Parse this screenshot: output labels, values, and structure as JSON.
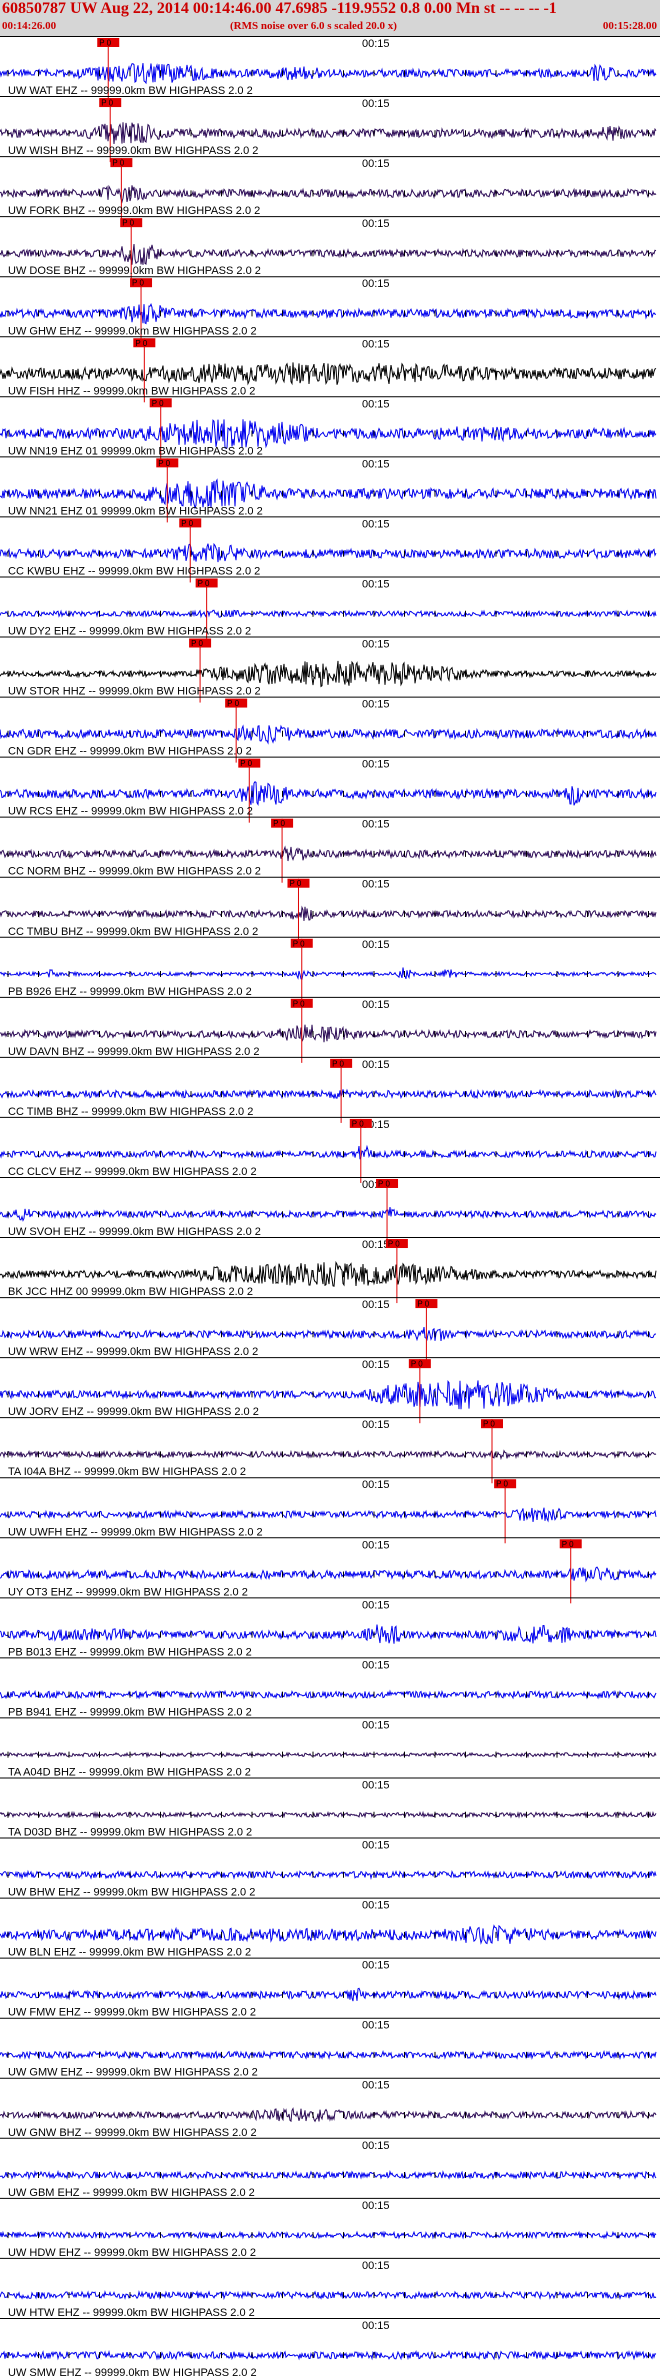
{
  "header": {
    "title": "60850787 UW Aug 22, 2014 00:14:46.00   47.6985 -119.9552  0.8 0.00 Mn st -- -- --  -1",
    "start_time": "00:14:26.00",
    "note": "(RMS noise over 6.0 s scaled 20.0 x)",
    "end_time": "00:15:28.00"
  },
  "time_marker": "00:15",
  "pick_label": "P 0",
  "colors": {
    "blue": "#0000ee",
    "black": "#000000",
    "purple": "#2b0a55",
    "pick": "#e00000"
  },
  "traces": [
    {
      "label": "UW WAT EHZ -- 99999.0km BW  HIGHPASS  2.0  2",
      "color": "blue",
      "amp": 0.55,
      "pick": 0.165,
      "burst": [
        0.12,
        0.42,
        2.6
      ],
      "extra": [
        [
          0.4,
          0.5,
          1.8
        ],
        [
          0.88,
          0.94,
          2.2
        ]
      ]
    },
    {
      "label": "UW WISH BHZ -- 99999.0km BW  HIGHPASS  2.0  2",
      "color": "purple",
      "amp": 0.6,
      "pick": 0.168,
      "burst": [
        0.13,
        0.3,
        2.6
      ],
      "extra": [
        [
          0.9,
          0.96,
          1.8
        ]
      ]
    },
    {
      "label": "UW FORK BHZ -- 99999.0km BW  HIGHPASS  2.0  2",
      "color": "purple",
      "amp": 0.55,
      "pick": 0.185,
      "burst": [
        0.15,
        0.26,
        2.2
      ],
      "extra": []
    },
    {
      "label": "UW DOSE BHZ -- 99999.0km BW  HIGHPASS  2.0  2",
      "color": "purple",
      "amp": 0.5,
      "pick": 0.2,
      "burst": [
        0.18,
        0.27,
        3.4
      ],
      "extra": []
    },
    {
      "label": "UW GHW EHZ -- 99999.0km BW  HIGHPASS  2.0  2",
      "color": "blue",
      "amp": 0.6,
      "pick": 0.215,
      "burst": [
        0.18,
        0.3,
        2.4
      ],
      "extra": []
    },
    {
      "label": "UW FISH HHZ -- 99999.0km BW  HIGHPASS  2.0  2",
      "color": "black",
      "amp": 0.8,
      "pick": 0.22,
      "burst": [
        0.2,
        1.0,
        2.0
      ],
      "extra": []
    },
    {
      "label": "UW NN19 EHZ 01 99999.0km BW  HIGHPASS  2.0  2",
      "color": "blue",
      "amp": 0.7,
      "pick": 0.245,
      "burst": [
        0.22,
        0.6,
        3.0
      ],
      "extra": [
        [
          0.65,
          0.8,
          1.6
        ]
      ]
    },
    {
      "label": "UW NN21 EHZ 01 99999.0km BW  HIGHPASS  2.0  2",
      "color": "blue",
      "amp": 0.7,
      "pick": 0.255,
      "burst": [
        0.22,
        0.5,
        3.0
      ],
      "extra": []
    },
    {
      "label": "CC KWBU EHZ -- 99999.0km BW  HIGHPASS  2.0  2",
      "color": "blue",
      "amp": 0.6,
      "pick": 0.29,
      "burst": [
        0.26,
        0.42,
        2.6
      ],
      "extra": []
    },
    {
      "label": "UW DY2 EHZ -- 99999.0km BW  HIGHPASS  2.0  2",
      "color": "blue",
      "amp": 0.35,
      "pick": 0.315,
      "burst": [
        0.3,
        0.4,
        1.6
      ],
      "extra": []
    },
    {
      "label": "UW STOR HHZ -- 99999.0km BW  HIGHPASS  2.0  2",
      "color": "black",
      "amp": 0.4,
      "pick": 0.305,
      "burst": [
        0.3,
        0.92,
        4.5
      ],
      "extra": []
    },
    {
      "label": "CN GDR EHZ -- 99999.0km BW  HIGHPASS  2.0  2",
      "color": "blue",
      "amp": 0.6,
      "pick": 0.36,
      "burst": [
        0.35,
        0.5,
        2.2
      ],
      "extra": []
    },
    {
      "label": "UW RCS EHZ -- 99999.0km BW  HIGHPASS  2.0  2",
      "color": "blue",
      "amp": 0.6,
      "pick": 0.38,
      "burst": [
        0.36,
        0.48,
        3.0
      ],
      "extra": [
        [
          0.86,
          0.89,
          3.2
        ]
      ]
    },
    {
      "label": "CC NORM BHZ -- 99999.0km BW  HIGHPASS  2.0  2",
      "color": "purple",
      "amp": 0.5,
      "pick": 0.43,
      "burst": [
        0.42,
        0.5,
        2.2
      ],
      "extra": []
    },
    {
      "label": "CC TMBU BHZ -- 99999.0km BW  HIGHPASS  2.0  2",
      "color": "purple",
      "amp": 0.45,
      "pick": 0.455,
      "burst": [
        0.44,
        0.5,
        2.4
      ],
      "extra": []
    },
    {
      "label": "PB B926 EHZ -- 99999.0km BW  HIGHPASS  2.0  2",
      "color": "blue",
      "amp": 0.25,
      "pick": 0.46,
      "burst": [
        0.45,
        0.48,
        3.0
      ],
      "extra": [
        [
          0.07,
          0.09,
          4.0
        ],
        [
          0.6,
          0.63,
          4.0
        ],
        [
          0.67,
          0.7,
          3.0
        ]
      ]
    },
    {
      "label": "UW DAVN BHZ -- 99999.0km BW  HIGHPASS  2.0  2",
      "color": "purple",
      "amp": 0.5,
      "pick": 0.46,
      "burst": [
        0.42,
        0.6,
        3.0
      ],
      "extra": []
    },
    {
      "label": "CC TIMB BHZ -- 99999.0km BW  HIGHPASS  2.0  2",
      "color": "blue",
      "amp": 0.5,
      "pick": 0.52,
      "burst": [
        0.5,
        0.55,
        1.5
      ],
      "extra": []
    },
    {
      "label": "CC CLCV EHZ -- 99999.0km BW  HIGHPASS  2.0  2",
      "color": "blue",
      "amp": 0.45,
      "pick": 0.55,
      "burst": [
        0.54,
        0.58,
        3.2
      ],
      "extra": []
    },
    {
      "label": "UW SVOH EHZ -- 99999.0km BW  HIGHPASS  2.0  2",
      "color": "blue",
      "amp": 0.45,
      "pick": 0.59,
      "burst": [
        0.58,
        0.62,
        2.2
      ],
      "extra": [
        [
          0.02,
          0.05,
          2.2
        ]
      ]
    },
    {
      "label": "BK JCC HHZ 00 99999.0km BW  HIGHPASS  2.0  2",
      "color": "black",
      "amp": 0.5,
      "pick": 0.605,
      "burst": [
        0.28,
        0.95,
        3.4
      ],
      "extra": []
    },
    {
      "label": "UW WRW EHZ -- 99999.0km BW  HIGHPASS  2.0  2",
      "color": "blue",
      "amp": 0.5,
      "pick": 0.65,
      "burst": [
        0.62,
        0.72,
        2.2
      ],
      "extra": []
    },
    {
      "label": "UW JORV EHZ -- 99999.0km BW  HIGHPASS  2.0  2",
      "color": "blue",
      "amp": 0.5,
      "pick": 0.64,
      "burst": [
        0.55,
        0.98,
        4.2
      ],
      "extra": []
    },
    {
      "label": "TA I04A BHZ -- 99999.0km BW  HIGHPASS  2.0  2",
      "color": "purple",
      "amp": 0.4,
      "pick": 0.75,
      "burst": [
        0.74,
        0.8,
        1.6
      ],
      "extra": []
    },
    {
      "label": "UW UWFH EHZ -- 99999.0km BW  HIGHPASS  2.0  2",
      "color": "blue",
      "amp": 0.45,
      "pick": 0.77,
      "burst": [
        0.78,
        0.9,
        2.6
      ],
      "extra": []
    },
    {
      "label": "UY OT3 EHZ -- 99999.0km BW  HIGHPASS  2.0  2",
      "color": "blue",
      "amp": 0.55,
      "pick": 0.87,
      "burst": [
        0.86,
        0.98,
        2.0
      ],
      "extra": []
    },
    {
      "label": "PB B013 EHZ -- 99999.0km BW  HIGHPASS  2.0  2",
      "color": "blue",
      "amp": 0.55,
      "pick": null,
      "burst": [
        0.05,
        0.3,
        1.6
      ],
      "extra": [
        [
          0.55,
          0.62,
          2.8
        ],
        [
          0.75,
          0.9,
          2.4
        ]
      ]
    },
    {
      "label": "PB B941 EHZ -- 99999.0km BW  HIGHPASS  2.0  2",
      "color": "blue",
      "amp": 0.45,
      "pick": null,
      "burst": null,
      "extra": []
    },
    {
      "label": "TA A04D BHZ -- 99999.0km BW  HIGHPASS  2.0  2",
      "color": "purple",
      "amp": 0.25,
      "pick": null,
      "burst": null,
      "extra": []
    },
    {
      "label": "TA D03D BHZ -- 99999.0km BW  HIGHPASS  2.0  2",
      "color": "purple",
      "amp": 0.3,
      "pick": null,
      "burst": null,
      "extra": []
    },
    {
      "label": "UW BHW EHZ -- 99999.0km BW  HIGHPASS  2.0  2",
      "color": "blue",
      "amp": 0.45,
      "pick": null,
      "burst": null,
      "extra": []
    },
    {
      "label": "UW BLN EHZ -- 99999.0km BW  HIGHPASS  2.0  2",
      "color": "blue",
      "amp": 0.6,
      "pick": null,
      "burst": [
        0.05,
        0.95,
        1.5
      ],
      "extra": [
        [
          0.65,
          0.85,
          2.2
        ]
      ]
    },
    {
      "label": "UW FMW EHZ -- 99999.0km BW  HIGHPASS  2.0  2",
      "color": "blue",
      "amp": 0.5,
      "pick": null,
      "burst": [
        0.53,
        0.57,
        2.2
      ],
      "extra": []
    },
    {
      "label": "UW GMW EHZ -- 99999.0km BW  HIGHPASS  2.0  2",
      "color": "blue",
      "amp": 0.45,
      "pick": null,
      "burst": null,
      "extra": []
    },
    {
      "label": "UW GNW BHZ -- 99999.0km BW  HIGHPASS  2.0  2",
      "color": "purple",
      "amp": 0.45,
      "pick": null,
      "burst": [
        0.38,
        0.6,
        2.2
      ],
      "extra": []
    },
    {
      "label": "UW GBM EHZ -- 99999.0km BW  HIGHPASS  2.0  2",
      "color": "blue",
      "amp": 0.45,
      "pick": null,
      "burst": null,
      "extra": []
    },
    {
      "label": "UW HDW EHZ -- 99999.0km BW  HIGHPASS  2.0  2",
      "color": "blue",
      "amp": 0.4,
      "pick": null,
      "burst": null,
      "extra": []
    },
    {
      "label": "UW HTW EHZ -- 99999.0km BW  HIGHPASS  2.0  2",
      "color": "blue",
      "amp": 0.45,
      "pick": null,
      "burst": null,
      "extra": []
    },
    {
      "label": "UW SMW EHZ -- 99999.0km BW  HIGHPASS  2.0  2",
      "color": "blue",
      "amp": 0.5,
      "pick": null,
      "burst": null,
      "extra": []
    }
  ]
}
